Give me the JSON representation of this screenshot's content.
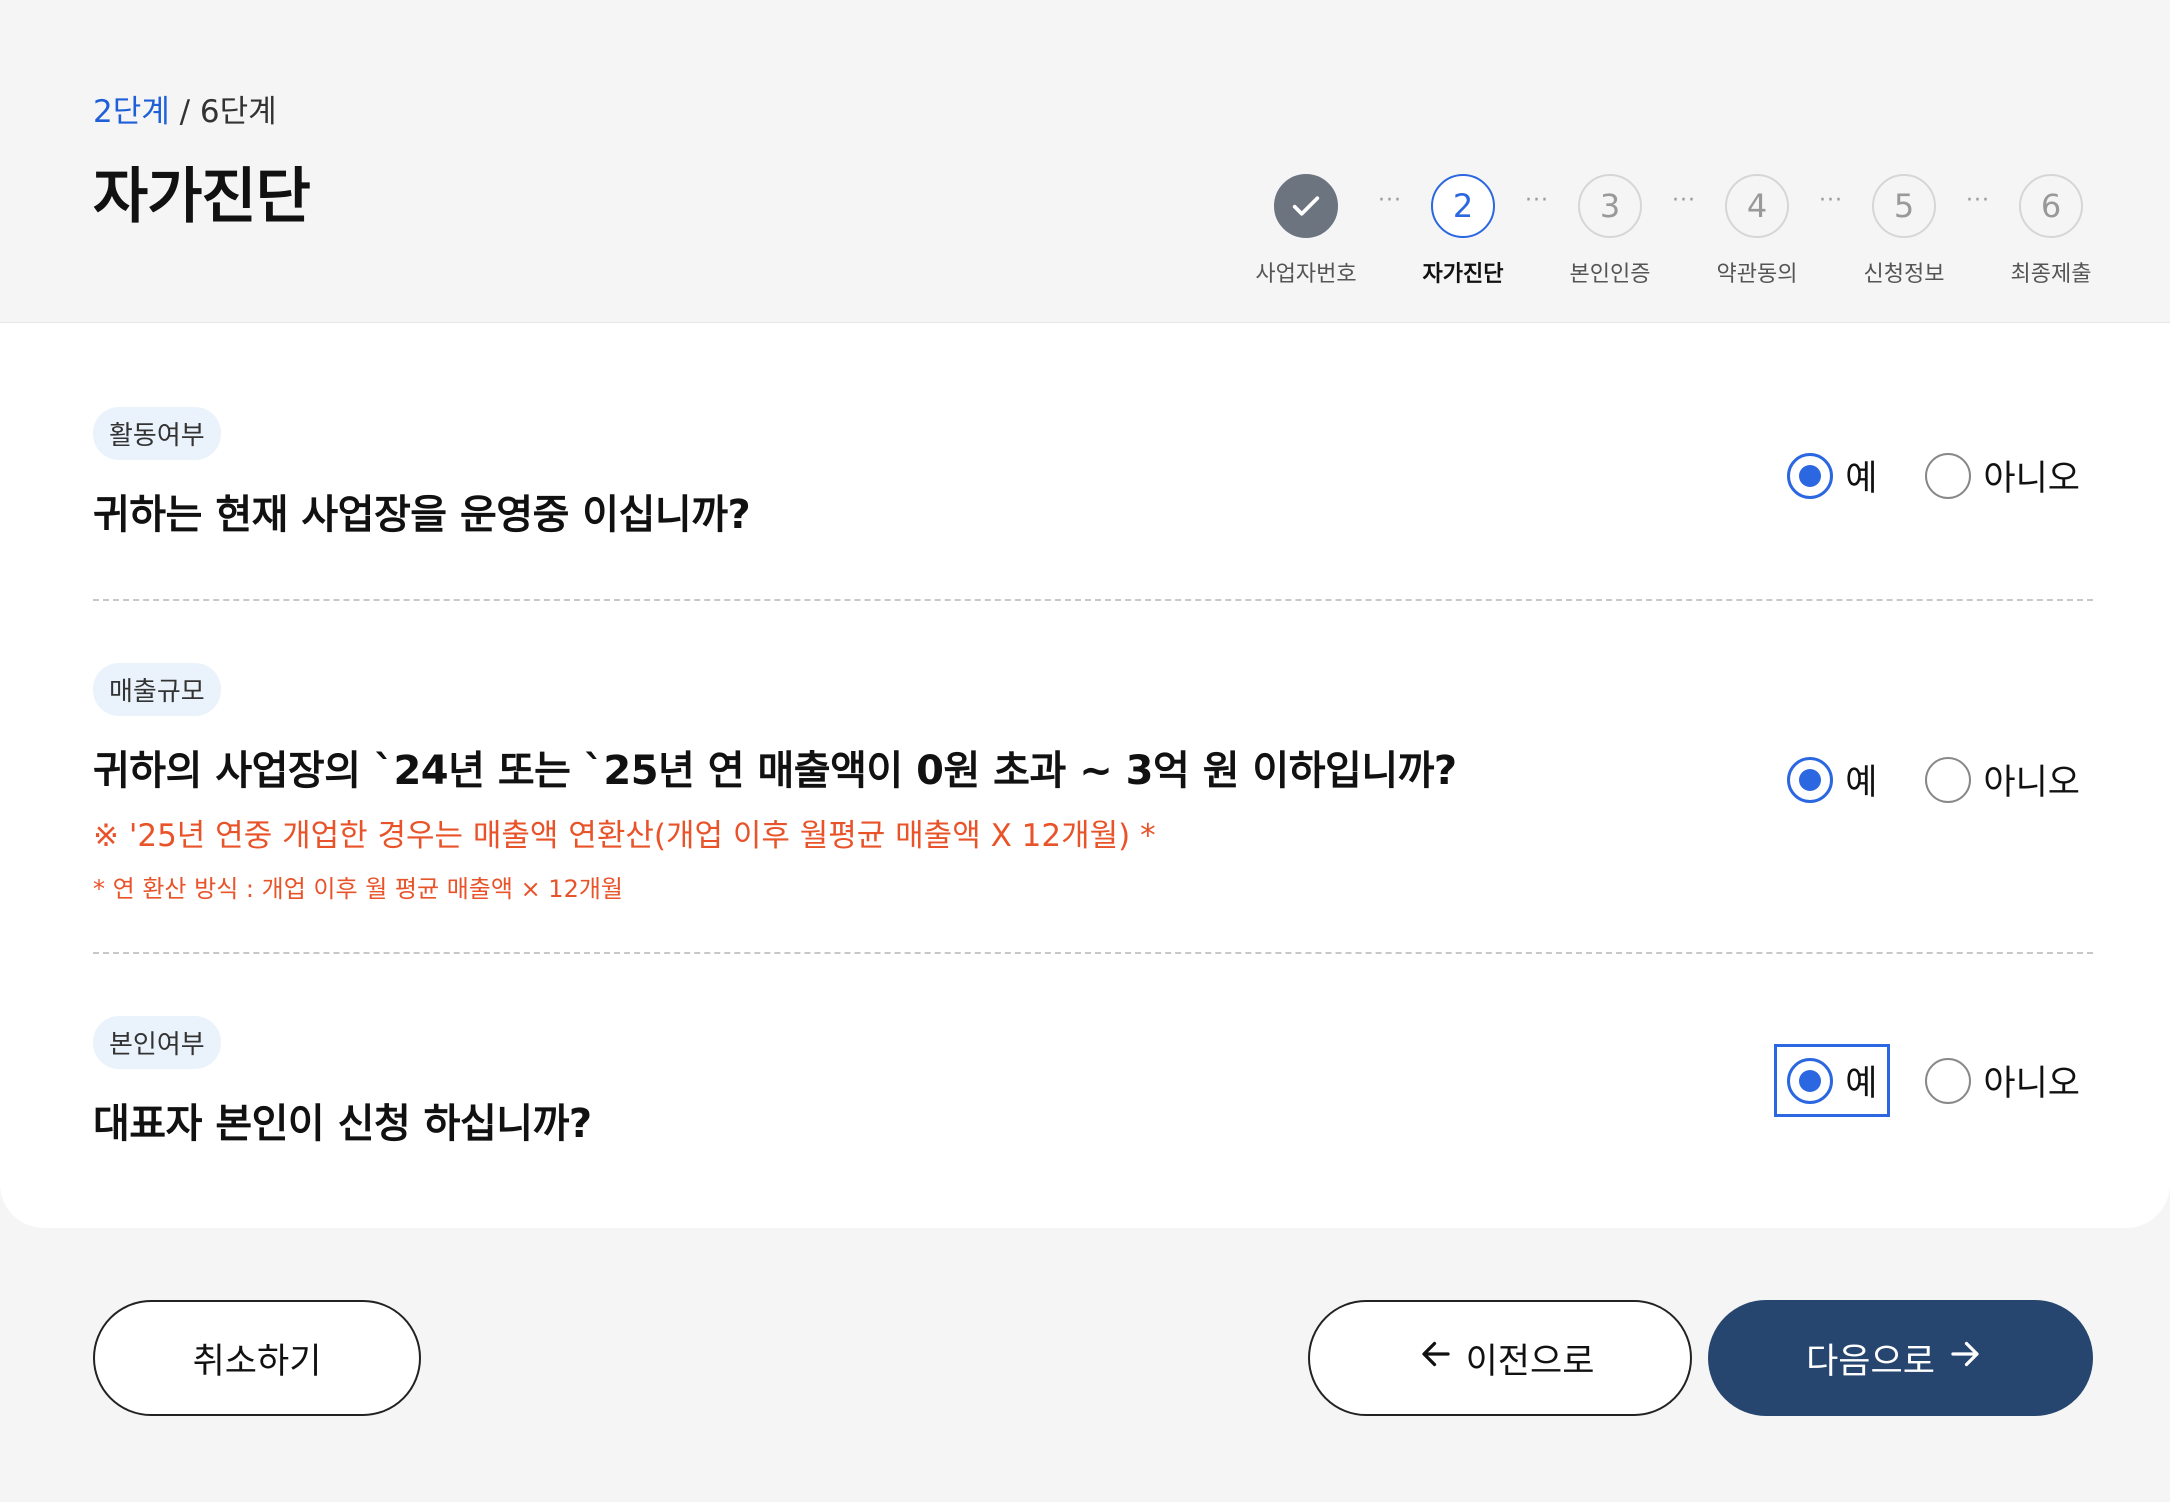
{
  "header": {
    "current_step": "2단계",
    "total_step": " / 6단계",
    "title": "자가진단"
  },
  "stepper": {
    "steps": [
      {
        "num": "",
        "label": "사업자번호",
        "state": "done"
      },
      {
        "num": "2",
        "label": "자가진단",
        "state": "active"
      },
      {
        "num": "3",
        "label": "본인인증",
        "state": "pending"
      },
      {
        "num": "4",
        "label": "약관동의",
        "state": "pending"
      },
      {
        "num": "5",
        "label": "신청정보",
        "state": "pending"
      },
      {
        "num": "6",
        "label": "최종제출",
        "state": "pending"
      }
    ],
    "separator": "···",
    "done_icon": "check-icon"
  },
  "questions": [
    {
      "tag": "활동여부",
      "text": "귀하는 현재 사업장을 운영중 이십니까?",
      "yes": "예",
      "no": "아니오",
      "selected": "yes"
    },
    {
      "tag": "매출규모",
      "text": "귀하의 사업장의 `24년 또는 `25년 연 매출액이 0원 초과 ~ 3억 원 이하입니까?",
      "note1": "※ '25년 연중 개업한 경우는 매출액 연환산(개업 이후 월평균 매출액 X 12개월) *",
      "note2": "* 연 환산 방식 : 개업 이후 월 평균 매출액 × 12개월",
      "yes": "예",
      "no": "아니오",
      "selected": "yes"
    },
    {
      "tag": "본인여부",
      "text": "대표자 본인이 신청 하십니까?",
      "yes": "예",
      "no": "아니오",
      "selected": "yes"
    }
  ],
  "buttons": {
    "cancel": "취소하기",
    "prev": "이전으로",
    "next": "다음으로",
    "prev_icon": "arrow-left-icon",
    "next_icon": "arrow-right-icon"
  },
  "colors": {
    "accent": "#2a67e0",
    "primary_button": "#27466f",
    "warning_text": "#e8532a",
    "done_step": "#6c7480"
  }
}
